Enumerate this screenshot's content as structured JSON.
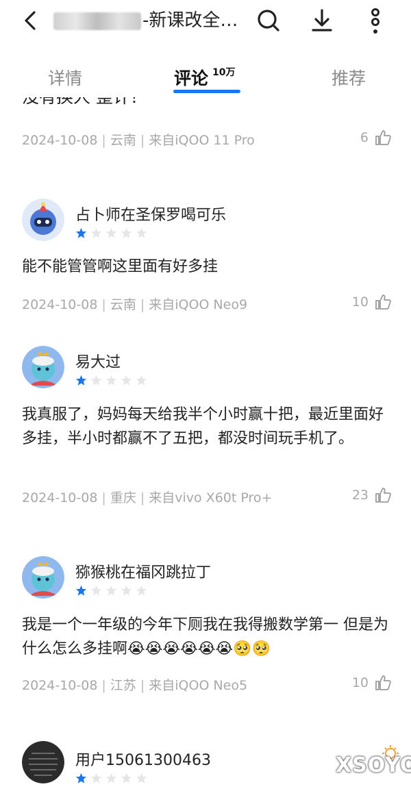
{
  "header": {
    "title": "-新课改全…",
    "back_icon": "chevron-left-icon",
    "search_icon": "search-icon",
    "download_icon": "download-icon",
    "more_icon": "more-vertical-icon"
  },
  "tabs": [
    {
      "label": "详情",
      "active": false
    },
    {
      "label": "评论",
      "badge": "10万",
      "active": true
    },
    {
      "label": "推荐",
      "active": false
    }
  ],
  "accent_color": "#1876f2",
  "comments_partial": {
    "content_fragment": "没有换人 整计？",
    "date": "2024-10-08",
    "region": "云南",
    "device": "来自iQOO 11 Pro",
    "likes": "6"
  },
  "comments": [
    {
      "username": "占卜师在圣保罗喝可乐",
      "rating": 1,
      "content": "能不能管管啊这里面有好多挂",
      "date": "2024-10-08",
      "region": "云南",
      "device": "来自iQOO Neo9",
      "likes": "10"
    },
    {
      "username": "易大过",
      "rating": 1,
      "content": "我真服了，妈妈每天给我半个小时赢十把，最近里面好多挂，半小时都赢不了五把，都没时间玩手机了。",
      "date": "2024-10-08",
      "region": "重庆",
      "device": "来自vivo X60t Pro+",
      "likes": "23"
    },
    {
      "username": "猕猴桃在福冈跳拉丁",
      "rating": 1,
      "content": "我是一个一年级的今年下厕我在我得搬数学第一 但是为什么怎么多挂啊😭😭😭😭😭😭🥺🥺",
      "date": "2024-10-08",
      "region": "江苏",
      "device": "来自iQOO Neo5",
      "likes": "10"
    },
    {
      "username": "用户15061300463",
      "rating": 1
    }
  ],
  "watermark": "XSOYO"
}
